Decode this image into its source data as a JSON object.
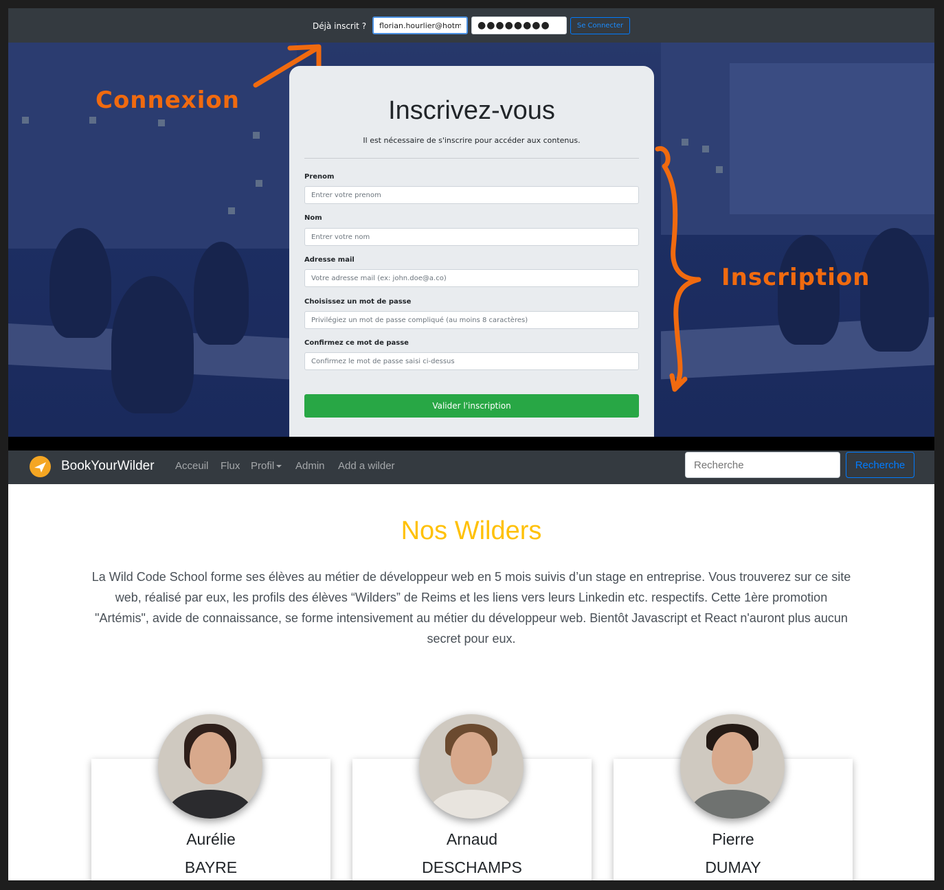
{
  "login": {
    "label": "Déjà inscrit ?",
    "email_value": "florian.hourlier@hotma",
    "password_value": "●●●●●●●●",
    "button_label": "Se Connecter"
  },
  "signup": {
    "title": "Inscrivez-vous",
    "subtitle": "Il est nécessaire de s'inscrire pour accéder aux contenus.",
    "fields": [
      {
        "label": "Prenom",
        "placeholder": "Entrer votre prenom"
      },
      {
        "label": "Nom",
        "placeholder": "Entrer votre nom"
      },
      {
        "label": "Adresse mail",
        "placeholder": "Votre adresse mail (ex: john.doe@a.co)"
      },
      {
        "label": "Choisissez un mot de passe",
        "placeholder": "Privilégiez un mot de passe compliqué (au moins 8 caractères)"
      },
      {
        "label": "Confirmez ce mot de passe",
        "placeholder": "Confirmez le mot de passe saisi ci-dessus"
      }
    ],
    "submit_label": "Valider l'inscription"
  },
  "annotations": {
    "connexion": "Connexion",
    "inscription": "Inscription",
    "color": "#f06a0f"
  },
  "navbar": {
    "brand": "BookYourWilder",
    "logo_icon": "paper-plane-icon",
    "links": [
      "Acceuil",
      "Flux",
      "Profil",
      "Admin",
      "Add a wilder"
    ],
    "search_placeholder": "Recherche",
    "search_button": "Recherche"
  },
  "main": {
    "title": "Nos Wilders",
    "title_color": "#ffc107",
    "intro": "La Wild Code School forme ses élèves au métier de développeur web en 5 mois suivis d’un stage en entreprise. Vous trouverez sur ce site web, réalisé par eux, les profils des élèves “Wilders” de Reims et les liens vers leurs Linkedin etc. respectifs. Cette 1ère promotion \"Artémis\", avide de connaissance, se forme intensivement au métier du développeur web. Bientôt Javascript et React n'auront plus aucun secret pour eux.",
    "wilders": [
      {
        "first": "Aurélie",
        "last": "BAYRE"
      },
      {
        "first": "Arnaud",
        "last": "DESCHAMPS"
      },
      {
        "first": "Pierre",
        "last": "DUMAY"
      }
    ]
  },
  "colors": {
    "topbar": "#343a40",
    "success": "#28a745",
    "primary": "#007bff"
  }
}
